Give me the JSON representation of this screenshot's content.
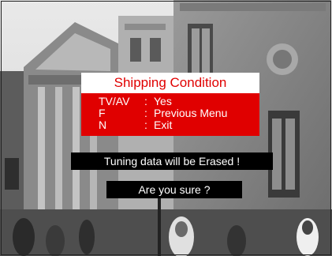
{
  "menu": {
    "title": "Shipping Condition",
    "items": [
      {
        "key": "TV/AV",
        "sep": ":",
        "label": "Yes"
      },
      {
        "key": "F",
        "sep": ":",
        "label": "Previous Menu"
      },
      {
        "key": "N",
        "sep": ":",
        "label": "Exit"
      }
    ]
  },
  "messages": {
    "warning": "Tuning data will be Erased !",
    "confirm": "Are you sure ?"
  },
  "colors": {
    "menu_red": "#e00000",
    "menu_title_bg": "#ffffff",
    "message_bg": "#000000",
    "text_white": "#ffffff"
  }
}
